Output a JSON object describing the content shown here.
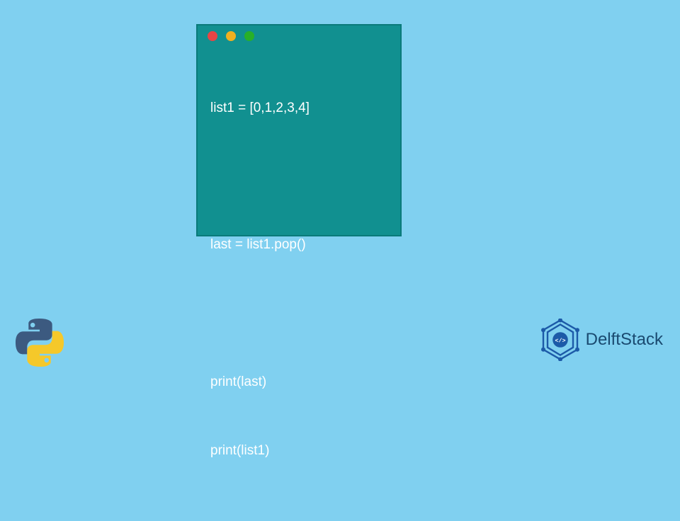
{
  "window": {
    "dots": [
      "red",
      "yellow",
      "green"
    ]
  },
  "code": {
    "lines": [
      "list1 = [0,1,2,3,4]",
      "",
      "last = list1.pop()",
      "",
      "print(last)",
      "print(list1)"
    ]
  },
  "brand": {
    "python_icon": "python-logo",
    "delftstack_icon": "delftstack-logo",
    "delftstack_text": "DelftStack"
  },
  "colors": {
    "background": "#80d0f0",
    "window": "#119090",
    "text": "#ffffff",
    "brand_blue": "#1a4a70",
    "python_blue": "#3c5a80",
    "python_yellow": "#f5c82a"
  }
}
